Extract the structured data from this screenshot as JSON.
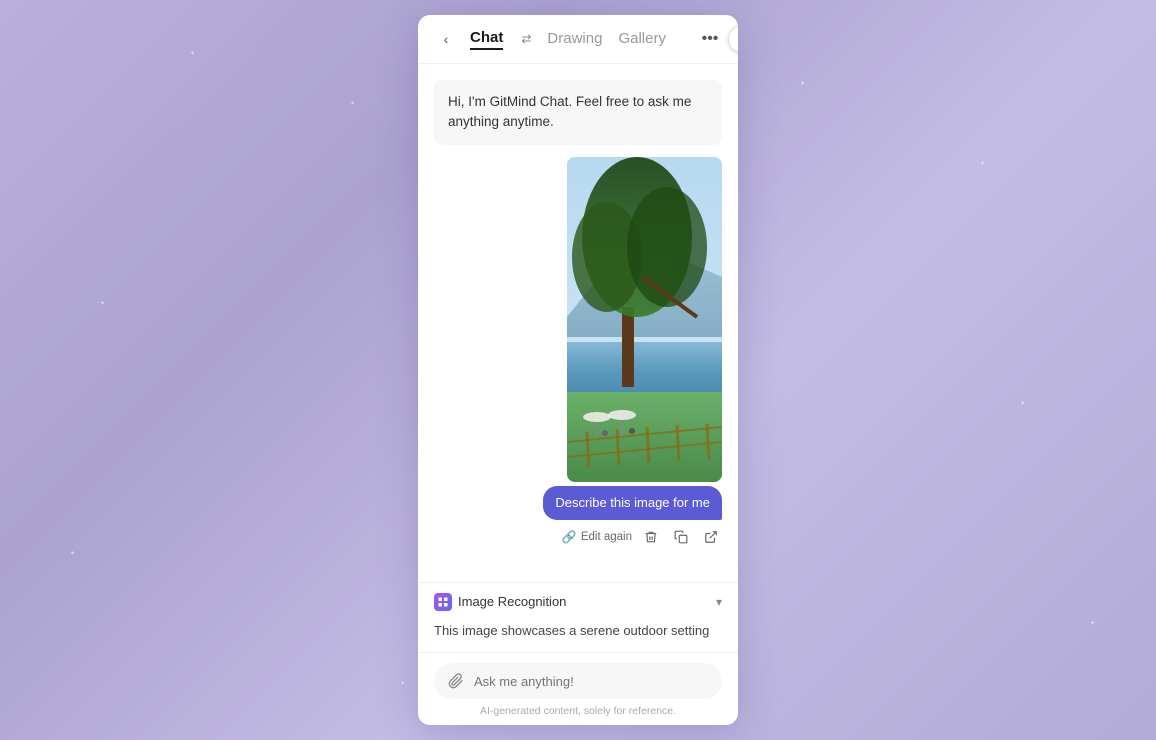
{
  "background": {
    "color": "#c4bce0"
  },
  "close_button": {
    "label": "✕"
  },
  "header": {
    "back_label": "‹",
    "tabs": [
      {
        "id": "chat",
        "label": "Chat",
        "active": true
      },
      {
        "id": "drawing",
        "label": "Drawing",
        "active": false
      },
      {
        "id": "gallery",
        "label": "Gallery",
        "active": false
      }
    ],
    "exchange_icon": "⇄",
    "more_icon": "···"
  },
  "welcome_message": "Hi, I'm GitMind Chat. Feel free to ask me anything anytime.",
  "user_message": "Describe this image for me",
  "actions": {
    "edit_again": "Edit again",
    "edit_icon": "🔗",
    "delete_icon": "🗑",
    "copy_icon": "⧉",
    "share_icon": "↗"
  },
  "right_tab": "›",
  "recognition": {
    "title": "Image Recognition",
    "icon": "🔮",
    "body": "This image showcases a serene outdoor setting",
    "chevron": "▾"
  },
  "input": {
    "placeholder": "Ask me anything!",
    "attach_icon": "📎",
    "disclaimer": "AI-generated content, solely for reference."
  }
}
